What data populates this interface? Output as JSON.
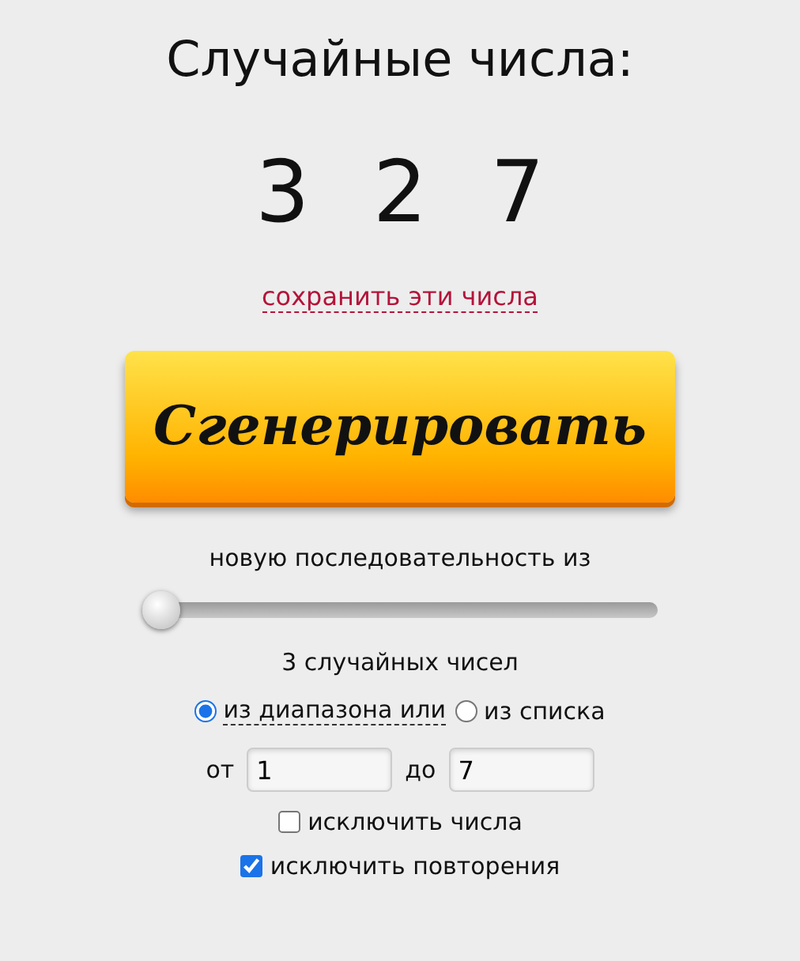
{
  "title": "Случайные числа:",
  "numbers": [
    "3",
    "2",
    "7"
  ],
  "save_link": "сохранить эти числа",
  "generate_button": "Сгенерировать",
  "sequence_label": "новую последовательность из",
  "slider": {
    "level": 0
  },
  "count_label": "3 случайных чисел",
  "source": [
    {
      "label": "из диапазона или",
      "selected": true,
      "dotted": true
    },
    {
      "label": "из списка",
      "selected": false,
      "dotted": false
    }
  ],
  "range": {
    "from_label": "от",
    "from_value": "1",
    "to_label": "до",
    "to_value": "7"
  },
  "options": [
    {
      "label": "исключить числа",
      "checked": false
    },
    {
      "label": "исключить повторения",
      "checked": true
    }
  ]
}
